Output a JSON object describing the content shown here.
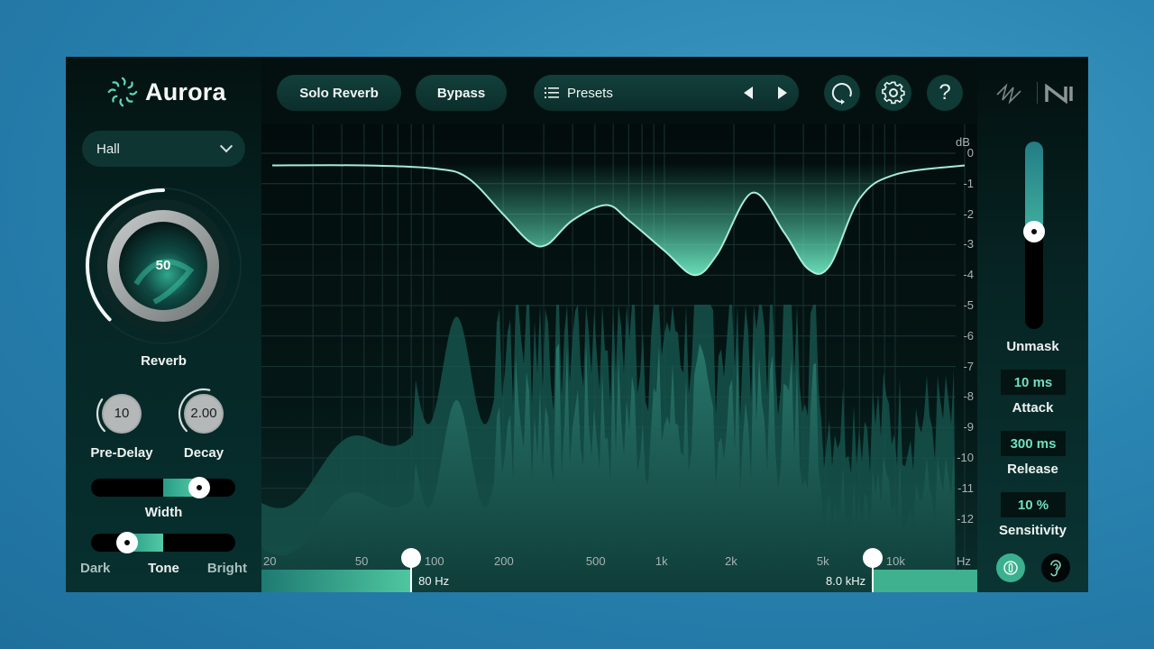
{
  "app": {
    "name": "Aurora",
    "logo_icon": "aurora-logo-icon"
  },
  "left_panel": {
    "room_type": {
      "value": "Hall",
      "icon": "chevron-down-icon"
    },
    "reverb": {
      "label": "Reverb",
      "value": "50",
      "fraction": 0.5
    },
    "pre_delay": {
      "label": "Pre-Delay",
      "value": "10",
      "fraction": 0.3
    },
    "decay": {
      "label": "Decay",
      "value": "2.00",
      "fraction": 0.55
    },
    "width": {
      "label": "Width",
      "fraction": 0.75
    },
    "tone": {
      "label": "Tone",
      "left_label": "Dark",
      "right_label": "Bright",
      "fraction": 0.25
    }
  },
  "toolbar": {
    "solo_reverb_label": "Solo Reverb",
    "bypass_label": "Bypass",
    "presets_label": "Presets",
    "presets_icon": "list-icon",
    "prev_icon": "triangle-left-icon",
    "next_icon": "triangle-right-icon",
    "undo_icon": "undo-icon",
    "settings_icon": "gear-icon",
    "help_icon": "question-icon",
    "help_glyph": "?",
    "brand_icons": [
      "izotope-logo-icon",
      "ni-logo-icon"
    ]
  },
  "graph": {
    "db_unit": "dB",
    "db_ticks": [
      "0",
      "-1",
      "-2",
      "-3",
      "-4",
      "-5",
      "-6",
      "-7",
      "-8",
      "-9",
      "-10",
      "-11",
      "-12"
    ],
    "freq_ticks": [
      "20",
      "50",
      "100",
      "200",
      "500",
      "1k",
      "2k",
      "5k",
      "10k",
      "Hz"
    ],
    "low_cut": {
      "label": "80 Hz",
      "hz": 80
    },
    "high_cut": {
      "label": "8.0 kHz",
      "hz": 8000
    },
    "curve_db": [
      {
        "hz": 20,
        "db": -0.4
      },
      {
        "hz": 50,
        "db": -0.4
      },
      {
        "hz": 100,
        "db": -0.5
      },
      {
        "hz": 140,
        "db": -0.8
      },
      {
        "hz": 200,
        "db": -2.0
      },
      {
        "hz": 260,
        "db": -2.9
      },
      {
        "hz": 310,
        "db": -3.0
      },
      {
        "hz": 400,
        "db": -2.2
      },
      {
        "hz": 560,
        "db": -1.7
      },
      {
        "hz": 700,
        "db": -2.2
      },
      {
        "hz": 1000,
        "db": -3.2
      },
      {
        "hz": 1350,
        "db": -4.0
      },
      {
        "hz": 1700,
        "db": -3.3
      },
      {
        "hz": 2400,
        "db": -1.3
      },
      {
        "hz": 3300,
        "db": -2.6
      },
      {
        "hz": 4200,
        "db": -3.8
      },
      {
        "hz": 5200,
        "db": -3.7
      },
      {
        "hz": 7000,
        "db": -1.5
      },
      {
        "hz": 10000,
        "db": -0.7
      },
      {
        "hz": 20000,
        "db": -0.4
      }
    ]
  },
  "right_panel": {
    "unmask": {
      "label": "Unmask",
      "fraction": 0.52
    },
    "attack": {
      "label": "Attack",
      "value": "10 ms"
    },
    "release": {
      "label": "Release",
      "value": "300 ms"
    },
    "sensitivity": {
      "label": "Sensitivity",
      "value": "10 %"
    },
    "buttons": [
      "power-toggle-icon",
      "ear-listen-icon"
    ]
  },
  "colors": {
    "accent": "#52c9a6",
    "curve": "#9fe8d0",
    "panel": "#04100f",
    "value_text": "#6fe0c0"
  }
}
